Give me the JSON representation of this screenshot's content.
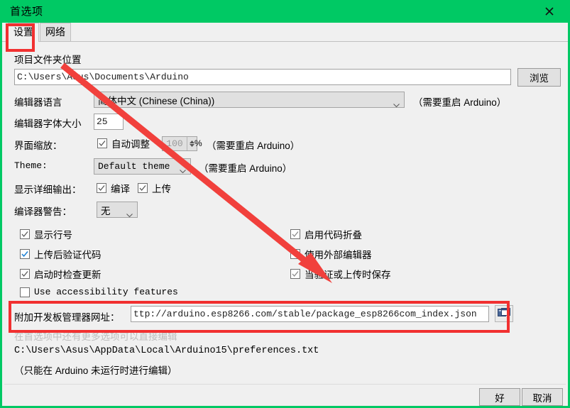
{
  "window": {
    "title": "首选项",
    "close_icon": "close-icon",
    "titlebar_color": "#00c964"
  },
  "tabs": [
    {
      "label": "设置",
      "active": true
    },
    {
      "label": "网络",
      "active": false
    }
  ],
  "settings": {
    "sketchbook_label": "项目文件夹位置",
    "sketchbook_path": "C:\\Users\\Asus\\Documents\\Arduino",
    "browse_button": "浏览",
    "language_label": "编辑器语言",
    "language_value": "简体中文  (Chinese  (China))",
    "language_note": "（需要重启 Arduino）",
    "fontsize_label": "编辑器字体大小",
    "fontsize_value": "25",
    "scale_label": "界面缩放：",
    "scale_auto_label": "自动调整",
    "scale_auto_checked": true,
    "scale_value": "100",
    "scale_percent": "%",
    "scale_note": "（需要重启 Arduino）",
    "theme_label": "Theme:",
    "theme_value": "Default theme",
    "theme_note": "（需要重启 Arduino）",
    "verbose_label": "显示详细输出：",
    "verbose_compile_label": "编译",
    "verbose_compile_checked": true,
    "verbose_upload_label": "上传",
    "verbose_upload_checked": true,
    "warnings_label": "编译器警告：",
    "warnings_value": "无"
  },
  "checkboxes_left": [
    {
      "label": "显示行号",
      "checked": true,
      "mono": false,
      "accent": false
    },
    {
      "label": "上传后验证代码",
      "checked": true,
      "mono": false,
      "accent": true
    },
    {
      "label": "启动时检查更新",
      "checked": true,
      "mono": false,
      "accent": false
    },
    {
      "label": "Use accessibility features",
      "checked": false,
      "mono": true,
      "accent": false
    }
  ],
  "checkboxes_right": [
    {
      "label": "启用代码折叠",
      "checked": true,
      "mono": false,
      "accent": false
    },
    {
      "label": "使用外部编辑器",
      "checked": false,
      "mono": false,
      "accent": false
    },
    {
      "label": "当验证或上传时保存",
      "checked": true,
      "mono": false,
      "accent": false
    }
  ],
  "board_urls": {
    "label": "附加开发板管理器网址：",
    "value": "ttp://arduino.esp8266.com/stable/package_esp8266com_index.json",
    "edit_icon": "windows-dialog-icon"
  },
  "footer_notes": {
    "more_prefs": "在首选项中还有更多选项可以直接编辑",
    "prefs_path": "C:\\Users\\Asus\\AppData\\Local\\Arduino15\\preferences.txt",
    "edit_note": "（只能在 Arduino 未运行时进行编辑）"
  },
  "buttons": {
    "ok": "好",
    "cancel": "取消"
  },
  "annotations": {
    "tab_highlight_color": "#f13030",
    "url_highlight_color": "#f13030",
    "arrow_color": "#f1403c"
  }
}
